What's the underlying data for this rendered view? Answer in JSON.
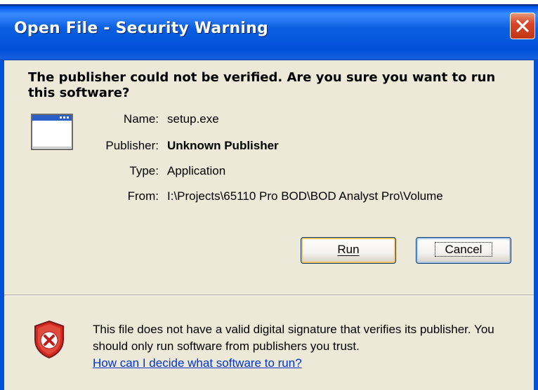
{
  "window": {
    "title": "Open File - Security Warning"
  },
  "dialog": {
    "headline": "The publisher could not be verified.  Are you sure you want to run this software?",
    "fields": [
      {
        "label": "Name:",
        "value": "setup.exe"
      },
      {
        "label": "Publisher:",
        "value": "Unknown Publisher"
      },
      {
        "label": "Type:",
        "value": "Application"
      },
      {
        "label": "From:",
        "value": "I:\\Projects\\65110 Pro BOD\\BOD Analyst Pro\\Volume"
      }
    ],
    "buttons": {
      "run_label": "Run",
      "cancel_label": "Cancel"
    },
    "warning": {
      "text": "This file does not have a valid digital signature that verifies its publisher.  You should only run software from publishers you trust.",
      "link": "How can I decide what software to run?"
    }
  },
  "icons": {
    "application": "application-window-icon",
    "shield": "security-shield-x-icon",
    "close": "close-icon"
  },
  "colors": {
    "titlebar": "#0050d8",
    "close_button": "#d8452a",
    "dialog_bg": "#ece9d8",
    "link": "#0033cc"
  }
}
